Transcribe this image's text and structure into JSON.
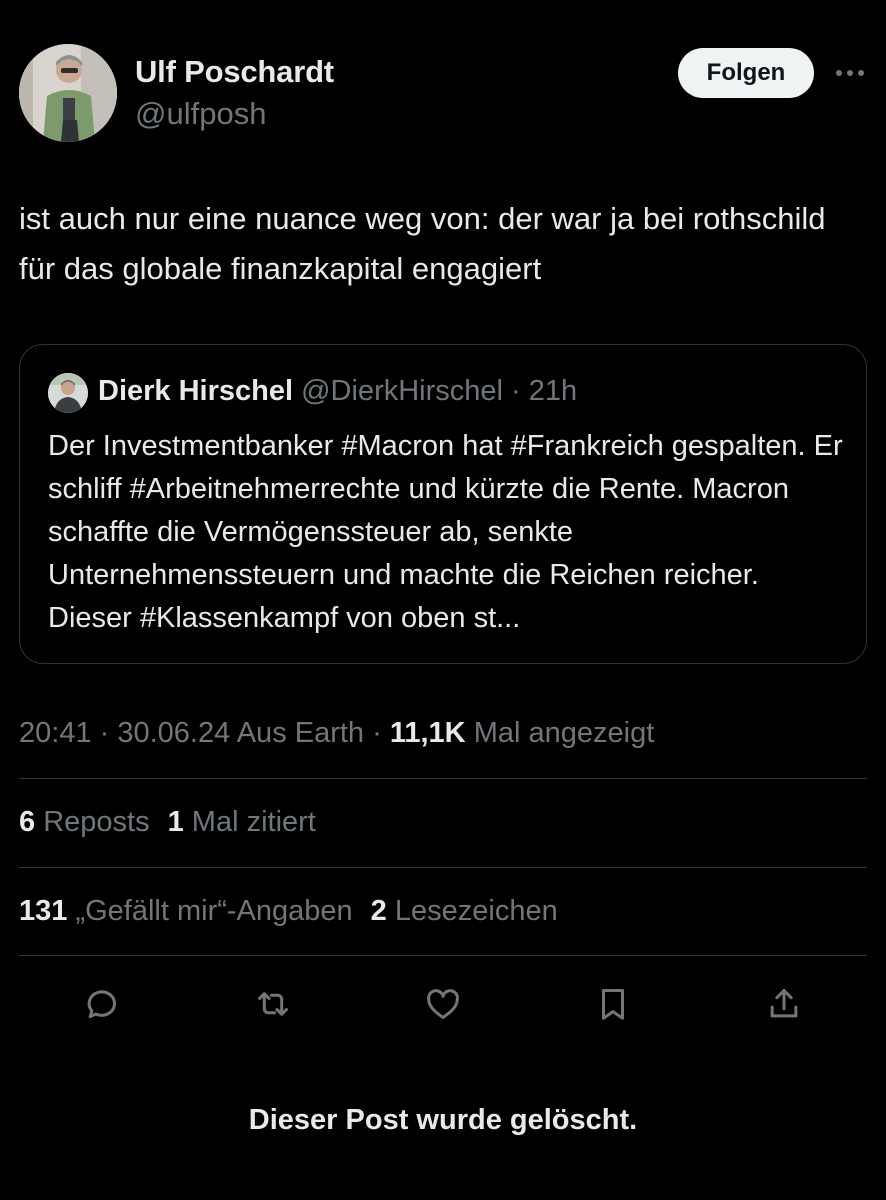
{
  "author": {
    "name": "Ulf Poschardt",
    "handle": "@ulfposh"
  },
  "follow_label": "Folgen",
  "more_label": "···",
  "post": {
    "text": "ist auch nur eine nuance weg von: der war ja bei rothschild für das globale finanzkapital engagiert"
  },
  "quote": {
    "name": "Dierk Hirschel",
    "handle": "@DierkHirschel",
    "separator": " · ",
    "time": "21h",
    "text": "Der Investmentbanker #Macron hat #Frankreich gespalten. Er schliff #Arbeitnehmerrechte und kürzte die Rente. Macron schaffte die Vermögenssteuer ab, senkte Unternehmenssteuern und machte die Reichen reicher. Dieser #Klassenkampf von oben st..."
  },
  "meta": {
    "time": "20:41",
    "separator": " · ",
    "date": "30.06.24",
    "location": "Aus Earth",
    "views": "11,1K",
    "views_label": "Mal angezeigt"
  },
  "stats": {
    "reposts": "6",
    "reposts_label": "Reposts",
    "quotes": "1",
    "quotes_label": "Mal zitiert",
    "likes": "131",
    "likes_label": "„Gefällt mir“-Angaben",
    "bookmarks": "2",
    "bookmarks_label": "Lesezeichen"
  },
  "actions": [
    "reply-icon",
    "repost-icon",
    "like-icon",
    "bookmark-icon",
    "share-icon"
  ],
  "footer": {
    "deleted_notice": "Dieser Post wurde gelöscht."
  },
  "colors": {
    "background": "#000000",
    "text": "#e7e9ea",
    "secondary": "#71767b",
    "border": "#2f3336",
    "follow_bg": "#eff3f4"
  }
}
